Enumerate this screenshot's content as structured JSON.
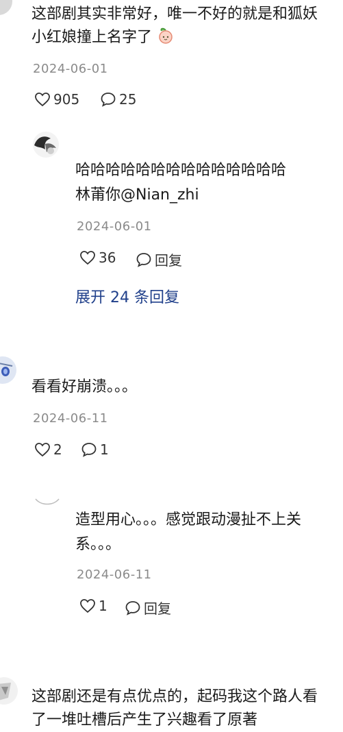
{
  "comment1": {
    "line1": "这部剧其实非常好，唯一不好的就是和狐妖",
    "line2": "小红娘撞上名字了",
    "date": "2024-06-01",
    "likes": "905",
    "comments": "25"
  },
  "reply1": {
    "line1": "哈哈哈哈哈哈哈哈哈哈哈哈哈哈",
    "line2": "林莆你@Nian_zhi",
    "date": "2024-06-01",
    "likes": "36",
    "reply_label": "回复",
    "expand": "展开 24 条回复"
  },
  "comment2": {
    "text": "看看好崩溃。。。",
    "date": "2024-06-11",
    "likes": "2",
    "comments": "1"
  },
  "reply2": {
    "line1": "造型用心。。。感觉跟动漫扯不上关",
    "line2": "系。。。",
    "date": "2024-06-11",
    "likes": "1",
    "reply_label": "回复"
  },
  "comment3": {
    "line1": "这部剧还是有点优点的，起码我这个路人看",
    "line2": "了一堆吐槽后产生了兴趣看了原著"
  },
  "icons": {
    "like": "heart-outline-icon",
    "comment": "speech-bubble-icon",
    "emoji": "peach-emoji-icon"
  },
  "colors": {
    "link": "#1f3f8a",
    "date": "#8a8a8a"
  }
}
